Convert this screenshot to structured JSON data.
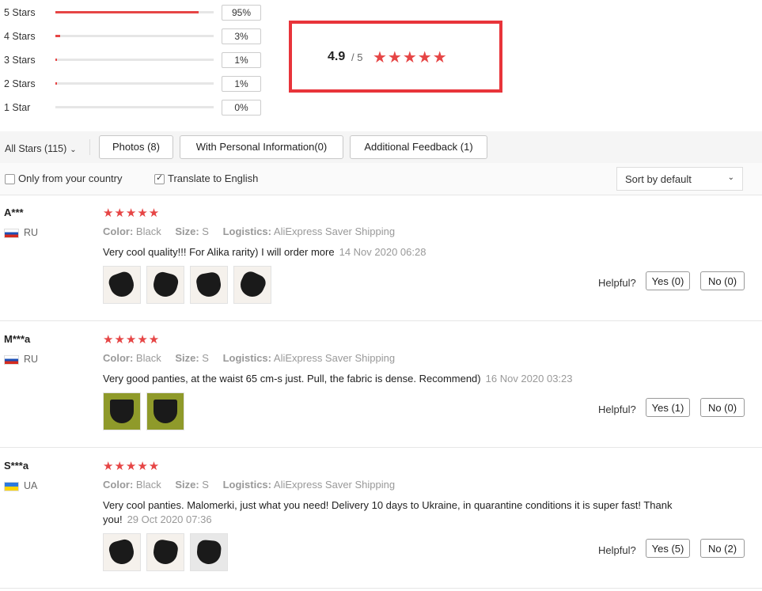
{
  "histogram": [
    {
      "label": "5 Stars",
      "percent_text": "95%",
      "fill_fraction": 0.95
    },
    {
      "label": "4 Stars",
      "percent_text": "3%",
      "fill_fraction": 0.03
    },
    {
      "label": "3 Stars",
      "percent_text": "1%",
      "fill_fraction": 0.01
    },
    {
      "label": "2 Stars",
      "percent_text": "1%",
      "fill_fraction": 0.01
    },
    {
      "label": "1 Star",
      "percent_text": "0%",
      "fill_fraction": 0.0
    }
  ],
  "rating": {
    "value": "4.9",
    "out_of": "/ 5",
    "stars": "★★★★★"
  },
  "filters": {
    "all_stars": "All Stars (115)",
    "photos": "Photos (8)",
    "personal": "With Personal Information(0)",
    "additional": "Additional Feedback (1)"
  },
  "options": {
    "only_country": "Only from your country",
    "only_country_checked": false,
    "translate": "Translate to English",
    "translate_checked": true,
    "sort": "Sort by default"
  },
  "helpful_label": "Helpful?",
  "attr_labels": {
    "color": "Color:",
    "size": "Size:",
    "logistics": "Logistics:"
  },
  "reviews": [
    {
      "name": "A***",
      "country": "RU",
      "flag": "ru",
      "stars": "★★★★★",
      "color": "Black",
      "size": "S",
      "logistics": "AliExpress Saver Shipping",
      "text": "Very cool quality!!! For Alika rarity) I will order more",
      "date": "14 Nov 2020 06:28",
      "thumbs": [
        "photo",
        "photo",
        "photo",
        "photo"
      ],
      "yes": "Yes (0)",
      "no": "No (0)"
    },
    {
      "name": "M***a",
      "country": "RU",
      "flag": "ru",
      "stars": "★★★★★",
      "color": "Black",
      "size": "S",
      "logistics": "AliExpress Saver Shipping",
      "text": "Very good panties, at the waist 65 cm-s just. Pull, the fabric is dense. Recommend)",
      "date": "16 Nov 2020 03:23",
      "thumbs": [
        "photo",
        "photo"
      ],
      "yes": "Yes (1)",
      "no": "No (0)"
    },
    {
      "name": "S***a",
      "country": "UA",
      "flag": "ua",
      "stars": "★★★★★",
      "color": "Black",
      "size": "S",
      "logistics": "AliExpress Saver Shipping",
      "text": "Very cool panties. Malomerki, just what you need! Delivery 10 days to Ukraine, in quarantine conditions it is super fast! Thank you!",
      "date": "29 Oct 2020 07:36",
      "thumbs": [
        "photo",
        "photo",
        "photo"
      ],
      "yes": "Yes (5)",
      "no": "No (2)"
    }
  ]
}
